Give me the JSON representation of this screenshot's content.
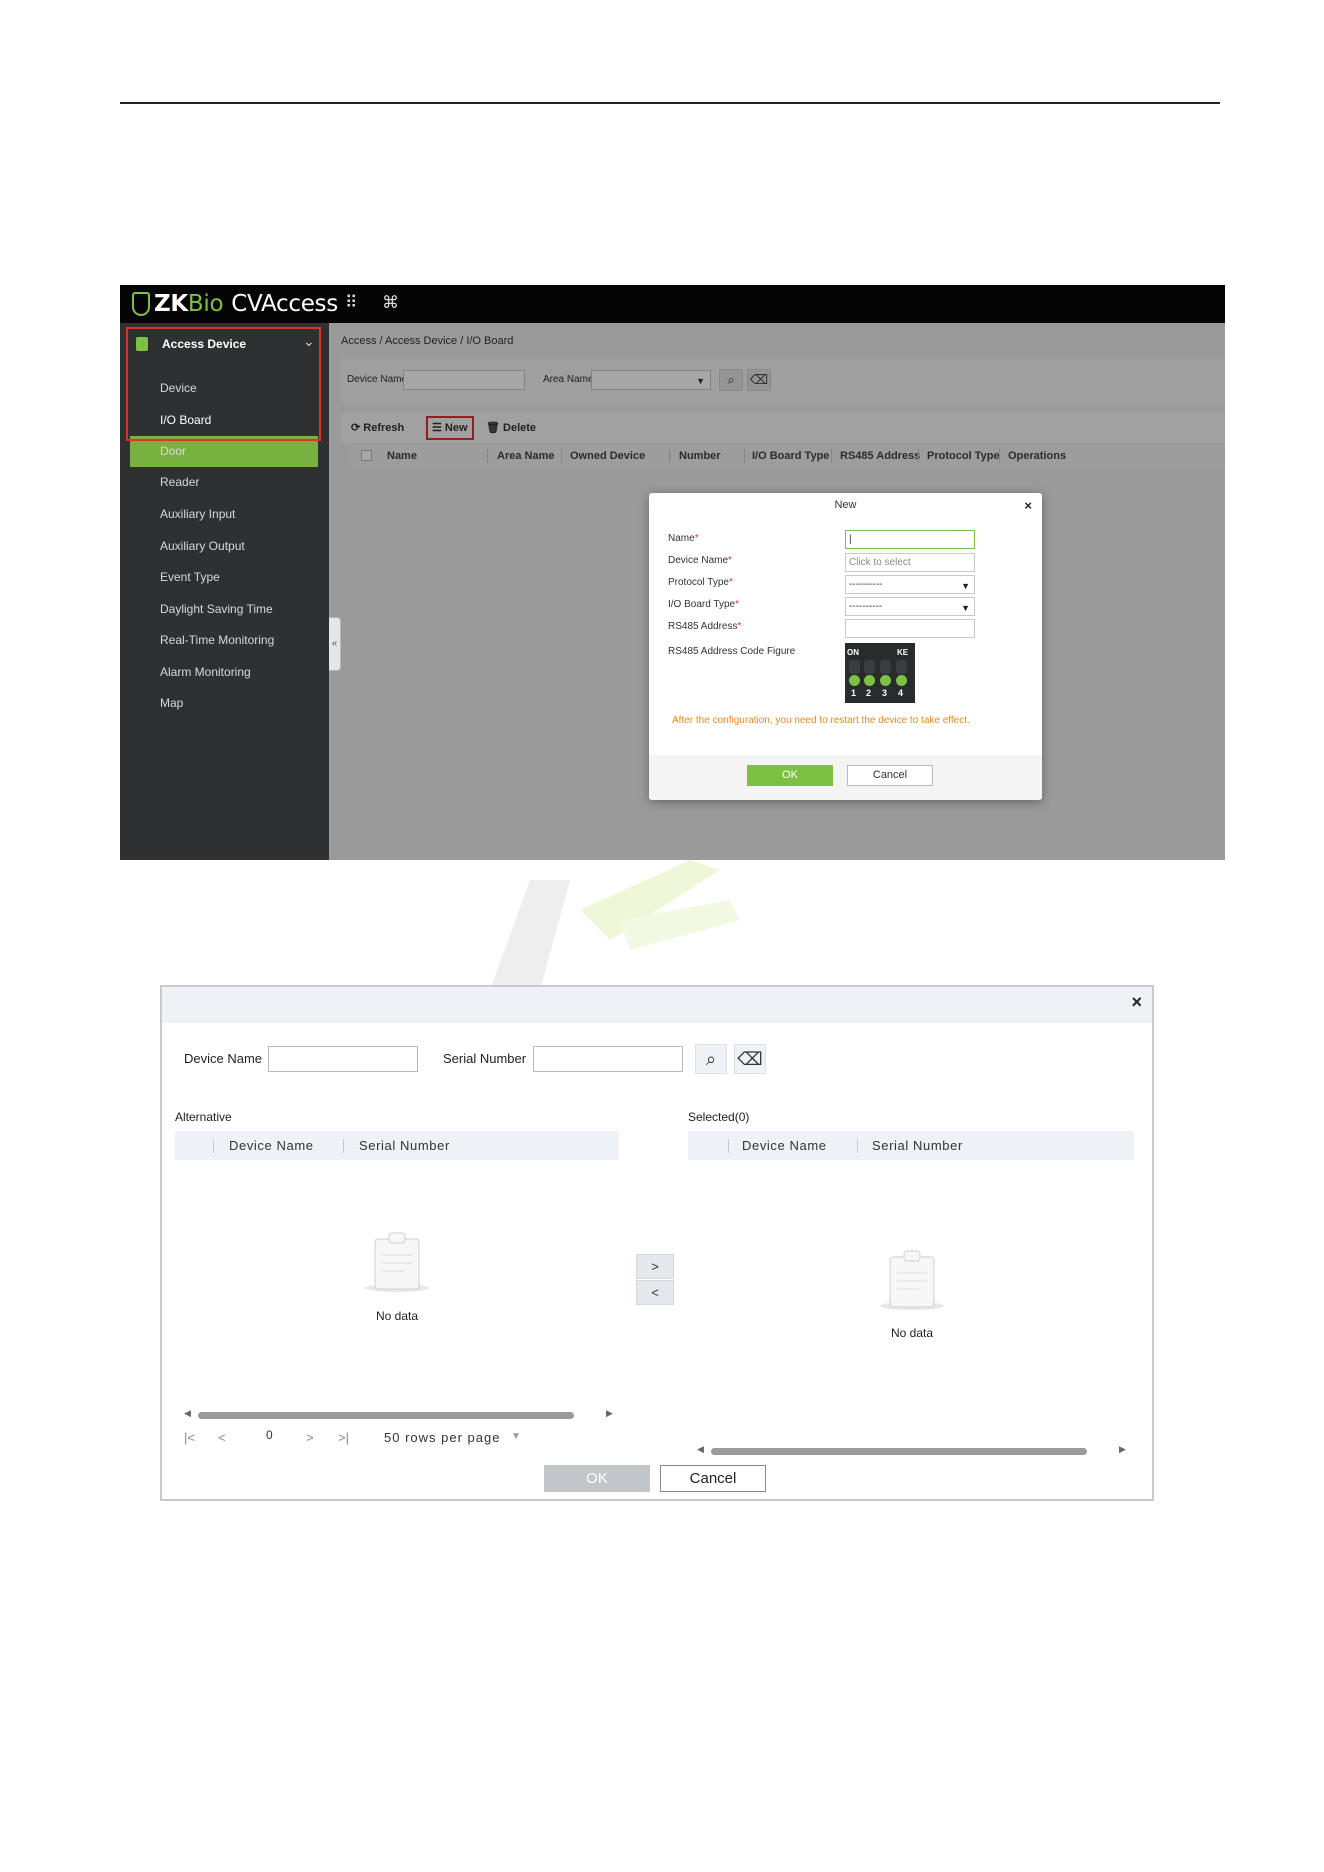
{
  "screen1": {
    "logo": {
      "zk": "ZK",
      "bio": "Bio",
      "name": "CVAccess"
    },
    "topbar_icons": [
      "apps-grid-icon",
      "command-icon"
    ],
    "sidebar": {
      "group_label": "Access Device",
      "items": [
        "Device",
        "I/O Board",
        "Door",
        "Reader",
        "Auxiliary Input",
        "Auxiliary Output",
        "Event Type",
        "Daylight Saving Time",
        "Real-Time Monitoring",
        "Alarm Monitoring",
        "Map"
      ],
      "active_item": "I/O Board",
      "collapse_glyph": "«"
    },
    "breadcrumb": "Access / Access Device / I/O Board",
    "search": {
      "device_name_label": "Device Name",
      "area_name_label": "Area Name"
    },
    "toolbar": {
      "refresh": "Refresh",
      "new": "New",
      "delete": "Delete"
    },
    "columns": [
      "Name",
      "Area Name",
      "Owned Device",
      "Number",
      "I/O Board Type",
      "RS485 Address",
      "Protocol Type",
      "Operations"
    ],
    "dialog": {
      "title": "New",
      "close": "×",
      "fields": [
        {
          "label": "Name",
          "required": true,
          "value": ""
        },
        {
          "label": "Device Name",
          "required": true,
          "placeholder": "Click to select"
        },
        {
          "label": "Protocol Type",
          "required": true,
          "value": "----------"
        },
        {
          "label": "I/O Board Type",
          "required": true,
          "value": "----------"
        },
        {
          "label": "RS485 Address",
          "required": true,
          "value": ""
        },
        {
          "label": "RS485 Address Code Figure",
          "required": false
        }
      ],
      "dip_switch": {
        "on_label": "ON",
        "ke_label": "KE",
        "numbers": [
          "1",
          "2",
          "3",
          "4"
        ]
      },
      "note": "After the configuration, you need to restart the device to take effect.",
      "ok": "OK",
      "cancel": "Cancel",
      "accent": "#7cc142",
      "note_color": "#e88a1e"
    }
  },
  "screen2": {
    "close": "×",
    "search": {
      "device_name_label": "Device Name",
      "serial_number_label": "Serial Number"
    },
    "alternative": {
      "title": "Alternative",
      "columns": [
        "Device Name",
        "Serial Number"
      ],
      "empty_text": "No data"
    },
    "selected": {
      "title": "Selected(0)",
      "columns": [
        "Device Name",
        "Serial Number"
      ],
      "empty_text": "No data"
    },
    "transfer": {
      "add": ">",
      "remove": "<"
    },
    "pager": {
      "first": "|<",
      "prev": "<",
      "page": "0",
      "next": ">",
      "last": ">|",
      "rows_per_page": "50 rows per page"
    },
    "ok": "OK",
    "cancel": "Cancel"
  }
}
